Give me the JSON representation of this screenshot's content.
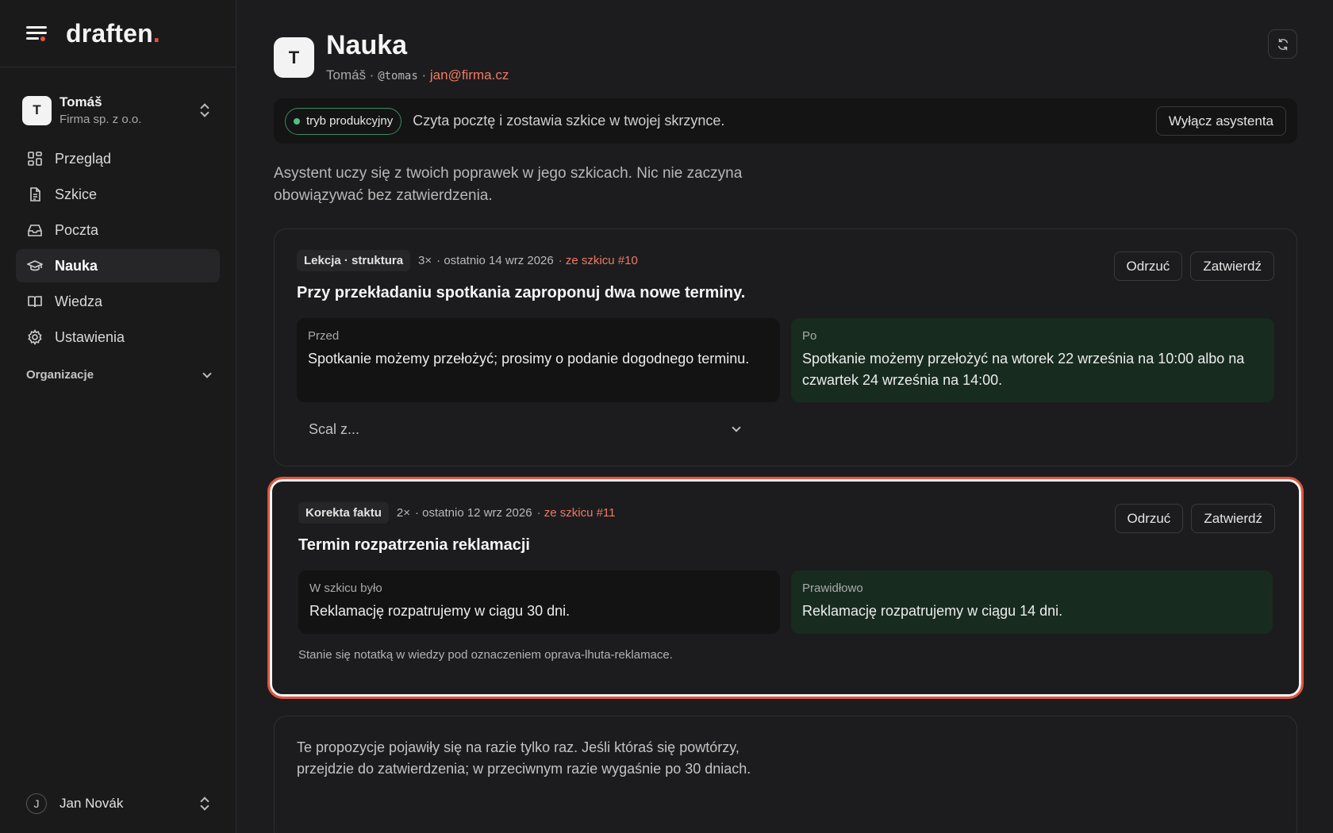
{
  "brand": {
    "name": "draften",
    "dot": "."
  },
  "org": {
    "initial": "T",
    "name": "Tomáš",
    "company": "Firma sp. z o.o."
  },
  "nav": [
    {
      "label": "Przegląd",
      "icon": "grid-icon"
    },
    {
      "label": "Szkice",
      "icon": "document-icon"
    },
    {
      "label": "Poczta",
      "icon": "inbox-icon"
    },
    {
      "label": "Nauka",
      "icon": "graduation-cap-icon",
      "active": true
    },
    {
      "label": "Wiedza",
      "icon": "book-icon"
    },
    {
      "label": "Ustawienia",
      "icon": "gear-icon"
    }
  ],
  "organizations_label": "Organizacje",
  "user": {
    "initial": "J",
    "name": "Jan Novák"
  },
  "header": {
    "initial": "T",
    "title": "Nauka",
    "name": "Tomáš",
    "sep1": " · ",
    "handle": "@tomas",
    "sep2": " · ",
    "email": "jan@firma.cz"
  },
  "status": {
    "badge": "tryb produkcyjny",
    "text": "Czyta pocztę i zostawia szkice w twojej skrzynce.",
    "button": "Wyłącz asystenta"
  },
  "intro": "Asystent uczy się z twoich poprawek w jego szkicach. Nic nie zaczyna obowiązywać bez zatwierdzenia.",
  "cards": [
    {
      "tag": "Lekcja · struktura",
      "count": "3×",
      "last": "· ostatnio 14 wrz 2026",
      "source": "· ze szkicu #10",
      "reject": "Odrzuć",
      "approve": "Zatwierdź",
      "title": "Przy przekładaniu spotkania zaproponuj dwa nowe terminy.",
      "before_label": "Przed",
      "before_text": "Spotkanie możemy przełożyć; prosimy o podanie dogodnego terminu.",
      "after_label": "Po",
      "after_text": "Spotkanie możemy przełożyć na wtorek 22 września na 10:00 albo na czwartek 24 września na 14:00.",
      "merge_placeholder": "Scal z..."
    },
    {
      "tag": "Korekta faktu",
      "count": "2×",
      "last": "· ostatnio 12 wrz 2026",
      "source": "· ze szkicu #11",
      "reject": "Odrzuć",
      "approve": "Zatwierdź",
      "title": "Termin rozpatrzenia reklamacji",
      "before_label": "W szkicu było",
      "before_text": "Reklamację rozpatrujemy w ciągu 30 dni.",
      "after_label": "Prawidłowo",
      "after_text": "Reklamację rozpatrujemy w ciągu 14 dni.",
      "note": "Stanie się notatką w wiedzy pod oznaczeniem oprava-lhuta-reklamace."
    }
  ],
  "pending_note": "Te propozycje pojawiły się na razie tylko raz. Jeśli któraś się powtórzy, przejdzie do zatwierdzenia; w przeciwnym razie wygaśnie po 30 dniach."
}
